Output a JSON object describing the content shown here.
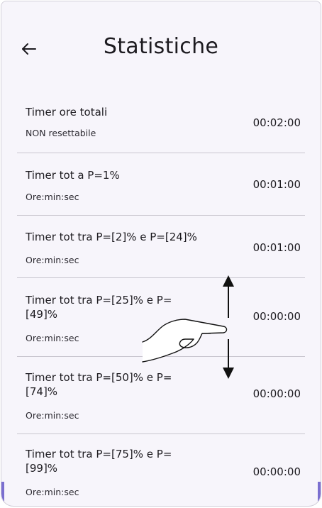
{
  "header": {
    "title": "Statistiche",
    "back_icon": "arrow-left-icon"
  },
  "stats": [
    {
      "title": "Timer ore totali",
      "subtitle": "NON resettabile",
      "value": "00:02:00"
    },
    {
      "title": "Timer tot a P=1%",
      "subtitle": "Ore:min:sec",
      "value": "00:01:00"
    },
    {
      "title": "Timer tot tra P=[2]% e P=[24]%",
      "subtitle": "Ore:min:sec",
      "value": "00:01:00"
    },
    {
      "title": "Timer tot tra P=[25]% e P=[49]%",
      "subtitle": "Ore:min:sec",
      "value": "00:00:00"
    },
    {
      "title": "Timer tot tra P=[50]% e P=[74]%",
      "subtitle": "Ore:min:sec",
      "value": "00:00:00"
    },
    {
      "title": "Timer tot tra P=[75]% e P=[99]%",
      "subtitle": "Ore:min:sec",
      "value": "00:00:00"
    }
  ],
  "overlay": {
    "gesture_icon": "hand-swipe-vertical-icon"
  },
  "colors": {
    "background": "#f7f5fb",
    "divider": "#c9c6cf",
    "text": "#1d1b20",
    "edge_accent": "#7b6fd0"
  }
}
